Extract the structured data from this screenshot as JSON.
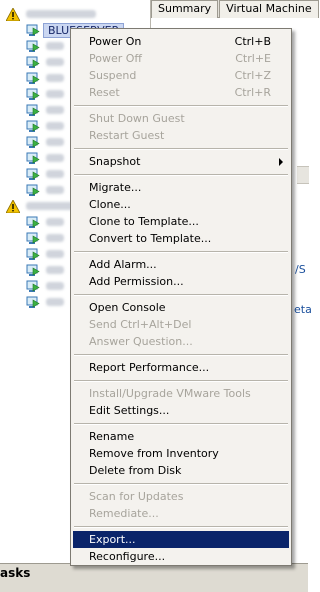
{
  "tree": {
    "selected_vm_label": "BLUESERVER",
    "vm_rows_count_visual": 14
  },
  "tabs": [
    {
      "label": "Summary"
    },
    {
      "label": "Virtual Machine"
    }
  ],
  "right_fragments": {
    "frag1": "/S",
    "frag2": "eta"
  },
  "tasks": {
    "label": "asks"
  },
  "context_menu": {
    "power_on": "Power On",
    "power_on_sc": "Ctrl+B",
    "power_off": "Power Off",
    "power_off_sc": "Ctrl+E",
    "suspend": "Suspend",
    "suspend_sc": "Ctrl+Z",
    "reset": "Reset",
    "reset_sc": "Ctrl+R",
    "shut_down_guest": "Shut Down Guest",
    "restart_guest": "Restart Guest",
    "snapshot": "Snapshot",
    "migrate": "Migrate...",
    "clone": "Clone...",
    "clone_to_template": "Clone to Template...",
    "convert_to_template": "Convert to Template...",
    "add_alarm": "Add Alarm...",
    "add_permission": "Add Permission...",
    "open_console": "Open Console",
    "send_ctrl_alt_del": "Send Ctrl+Alt+Del",
    "answer_question": "Answer Question...",
    "report_performance": "Report Performance...",
    "install_vmware_tools": "Install/Upgrade VMware Tools",
    "edit_settings": "Edit Settings...",
    "rename": "Rename",
    "remove_from_inventory": "Remove from Inventory",
    "delete_from_disk": "Delete from Disk",
    "scan_for_updates": "Scan for Updates",
    "remediate": "Remediate...",
    "export": "Export...",
    "reconfigure": "Reconfigure..."
  }
}
